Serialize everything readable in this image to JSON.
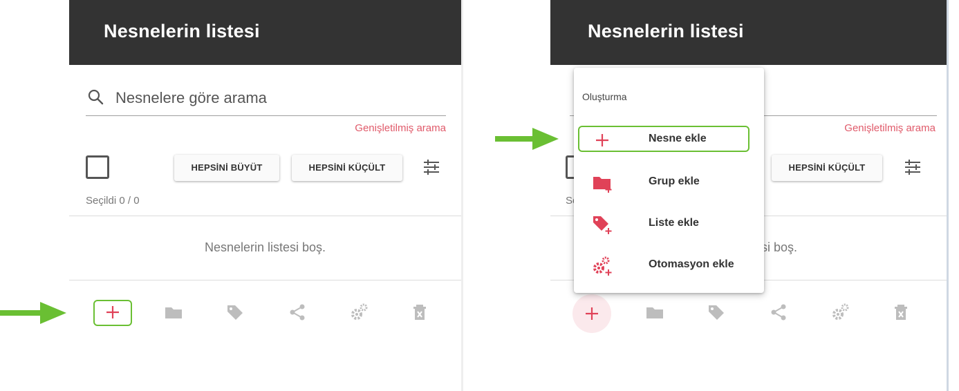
{
  "panel_left": {
    "header_title": "Nesnelerin listesi",
    "search_placeholder": "Nesnelere göre arama",
    "advanced_search": "Genişletilmiş arama",
    "expand_all": "HEPSİNİ BÜYÜT",
    "collapse_all": "HEPSİNİ KÜÇÜLT",
    "selected_count": "Seçildi 0 / 0",
    "empty_message": "Nesnelerin listesi boş."
  },
  "panel_right": {
    "header_title": "Nesnelerin listesi",
    "advanced_search": "Genişletilmiş arama",
    "collapse_all": "HEPSİNİ KÜÇÜLT",
    "selected_partial": "Se",
    "empty_partial": "tesi boş."
  },
  "menu": {
    "title": "Oluşturma",
    "items": [
      {
        "label": "Nesne ekle",
        "icon": "plus-icon"
      },
      {
        "label": "Grup ekle",
        "icon": "folder-plus-icon"
      },
      {
        "label": "Liste ekle",
        "icon": "tag-plus-icon"
      },
      {
        "label": "Otomasyon ekle",
        "icon": "gears-plus-icon"
      }
    ]
  },
  "toolbar_icons": [
    "plus-icon",
    "folder-icon",
    "tag-icon",
    "share-icon",
    "gears-icon",
    "delete-icon"
  ],
  "colors": {
    "header_bg": "#333333",
    "accent_red": "#e04258",
    "link_red": "#e05a6a",
    "highlight_green": "#6abf33",
    "icon_gray": "#bdbdbd"
  }
}
